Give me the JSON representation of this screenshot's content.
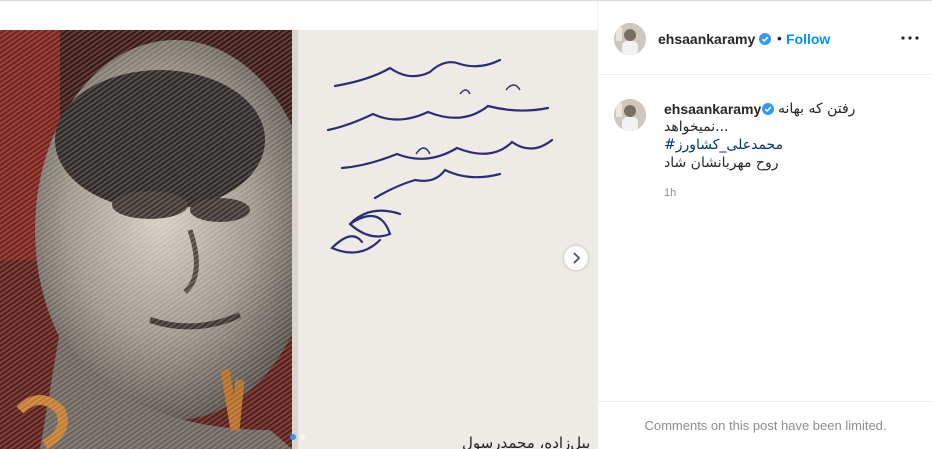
{
  "post": {
    "username": "ehsaankaramy",
    "follow_label": "Follow",
    "separator": "•",
    "caption_lines": [
      "رفتن که بهانه",
      "نمیخواهد...",
      "#محمدعلی_کشاورز",
      "روح مهربانشان شاد"
    ],
    "time": "1h",
    "comments_limited": "Comments on this post have been limited.",
    "image_caption": "پیل‌زاده، محمدرسول"
  },
  "carousel": {
    "total": 2,
    "current": 1
  },
  "colors": {
    "accent": "#0095f6",
    "verified": "#3897f0",
    "hashtag": "#00376b",
    "muted": "#8e8e8e"
  },
  "icons": {
    "verified": "verified-badge-icon",
    "more": "more-options-icon",
    "next": "chevron-right-icon"
  }
}
